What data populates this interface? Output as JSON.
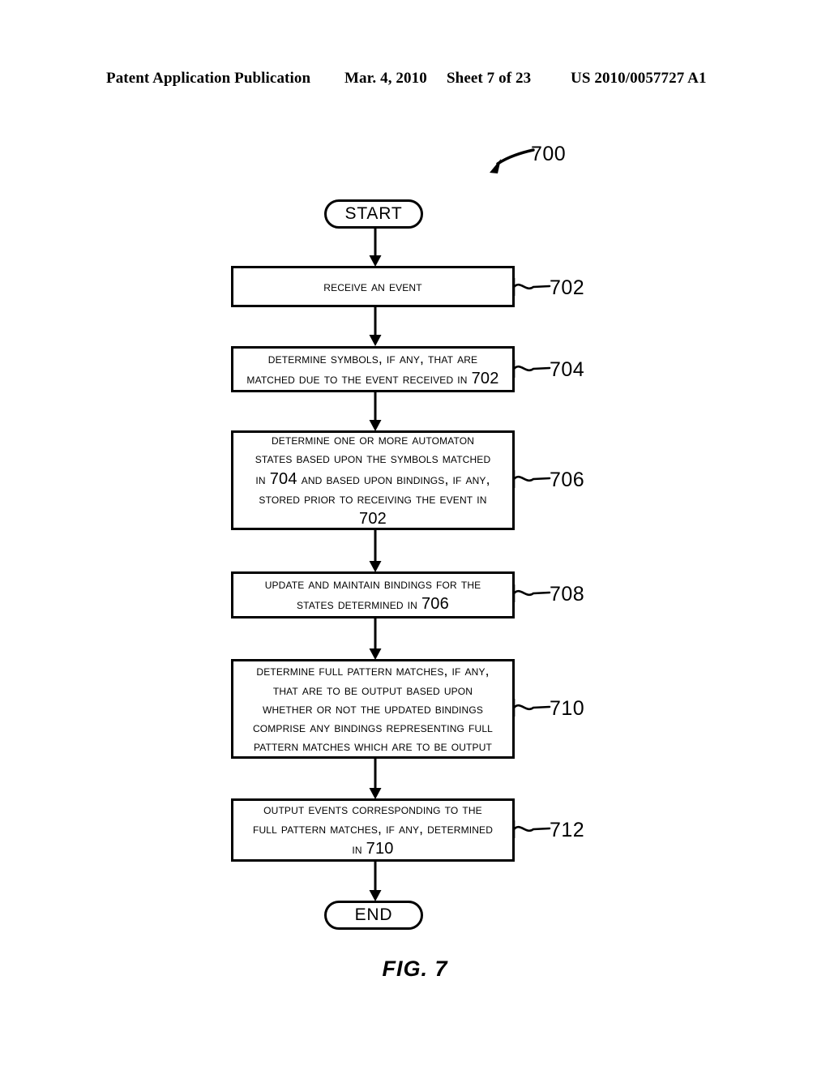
{
  "header": {
    "publication": "Patent Application Publication",
    "date": "Mar. 4, 2010",
    "sheet": "Sheet 7 of 23",
    "patent_number": "US 2010/0057727 A1"
  },
  "figure": {
    "caption": "FIG. 7",
    "figure_reference": "700",
    "start_label": "START",
    "end_label": "END",
    "steps": [
      {
        "ref": "702",
        "lines": [
          [
            {
              "t": "Receive an event"
            }
          ]
        ]
      },
      {
        "ref": "704",
        "lines": [
          [
            {
              "t": "Determine symbols, if any, that are"
            }
          ],
          [
            {
              "t": "matched due to the event received in "
            },
            {
              "n": "702"
            }
          ]
        ]
      },
      {
        "ref": "706",
        "lines": [
          [
            {
              "t": "Determine one or more automaton"
            }
          ],
          [
            {
              "t": "states based upon the symbols matched"
            }
          ],
          [
            {
              "t": "in "
            },
            {
              "n": "704"
            },
            {
              "t": " and based upon bindings, if any,"
            }
          ],
          [
            {
              "t": "stored prior to receiving the event in"
            }
          ],
          [
            {
              "n": "702"
            }
          ]
        ]
      },
      {
        "ref": "708",
        "lines": [
          [
            {
              "t": "Update and maintain bindings for the"
            }
          ],
          [
            {
              "t": "states determined in "
            },
            {
              "n": "706"
            }
          ]
        ]
      },
      {
        "ref": "710",
        "lines": [
          [
            {
              "t": "Determine full pattern matches, if any,"
            }
          ],
          [
            {
              "t": "that are to be output based upon"
            }
          ],
          [
            {
              "t": "whether or not the updated bindings"
            }
          ],
          [
            {
              "t": "comprise any bindings representing full"
            }
          ],
          [
            {
              "t": "pattern matches which are to be output"
            }
          ]
        ]
      },
      {
        "ref": "712",
        "lines": [
          [
            {
              "t": "Output events corresponding to the"
            }
          ],
          [
            {
              "t": "full pattern matches, if any, determined"
            }
          ],
          [
            {
              "t": "in "
            },
            {
              "n": "710"
            }
          ]
        ]
      }
    ]
  },
  "colors": {
    "ink": "#000000",
    "page": "#ffffff"
  }
}
